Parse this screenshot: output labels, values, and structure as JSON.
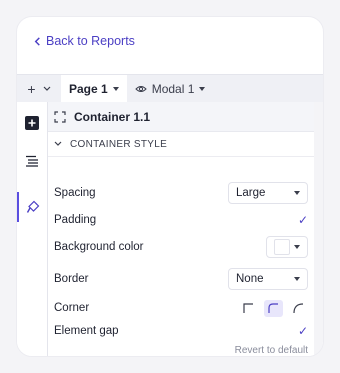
{
  "nav": {
    "back_label": "Back to Reports"
  },
  "topbar": {
    "add_symbol": "+",
    "tabs": [
      {
        "label": "Page 1",
        "active": true
      },
      {
        "label": "Modal 1",
        "active": false
      }
    ]
  },
  "component": {
    "name": "Container 1.1"
  },
  "section": {
    "title": "CONTAINER STYLE"
  },
  "props": {
    "spacing": {
      "label": "Spacing",
      "value": "Large"
    },
    "padding": {
      "label": "Padding",
      "checked": true
    },
    "background": {
      "label": "Background color",
      "value": "#ffffff"
    },
    "border": {
      "label": "Border",
      "value": "None"
    },
    "corner": {
      "label": "Corner",
      "options": [
        "square",
        "rounded",
        "round"
      ],
      "selected": "rounded"
    },
    "element_gap": {
      "label": "Element gap",
      "checked": true
    }
  },
  "revert_label": "Revert to default",
  "check_glyph": "✓",
  "colors": {
    "accent": "#4b3fc4",
    "selected_bg": "#e8e6fb"
  }
}
